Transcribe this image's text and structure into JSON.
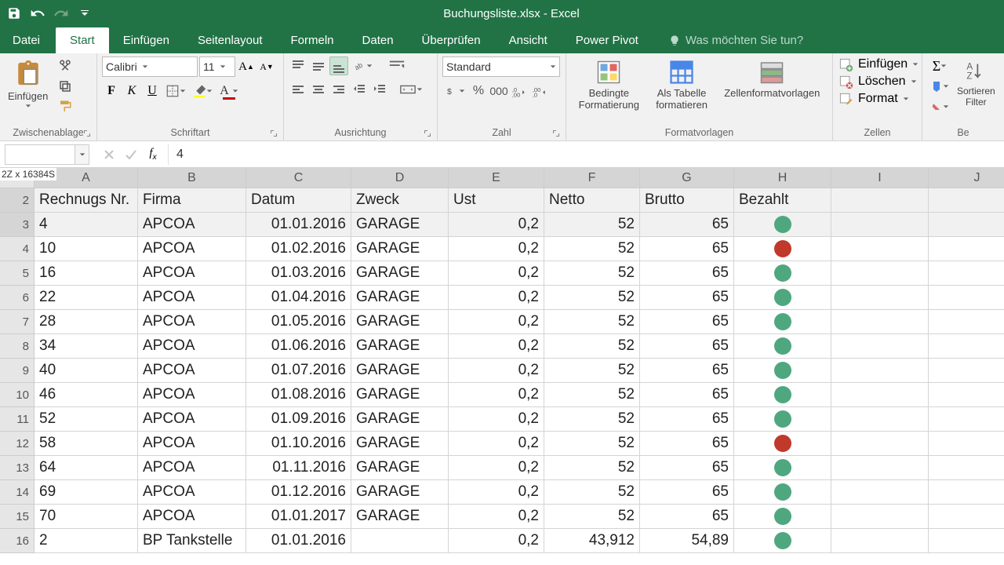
{
  "title": "Buchungsliste.xlsx - Excel",
  "tabs": {
    "file": "Datei",
    "home": "Start",
    "insert": "Einfügen",
    "layout": "Seitenlayout",
    "formulas": "Formeln",
    "data": "Daten",
    "review": "Überprüfen",
    "view": "Ansicht",
    "pivot": "Power Pivot"
  },
  "tellme": "Was möchten Sie tun?",
  "groups": {
    "clipboard": "Zwischenablage",
    "font": "Schriftart",
    "align": "Ausrichtung",
    "number": "Zahl",
    "styles": "Formatvorlagen",
    "cells": "Zellen",
    "editing": "Be"
  },
  "clipboard": {
    "paste": "Einfügen"
  },
  "font": {
    "name": "Calibri",
    "size": "11"
  },
  "number": {
    "format": "Standard"
  },
  "styles": {
    "cond": "Bedingte\nFormatierung",
    "table": "Als Tabelle\nformatieren",
    "cellstyles": "Zellenformatvorlagen"
  },
  "cells": {
    "insert": "Einfügen",
    "delete": "Löschen",
    "format": "Format"
  },
  "editing": {
    "sort": "Sortieren\nFilter"
  },
  "namebox": "",
  "formula": "4",
  "selection_size": "2Z x 16384S",
  "columns": [
    "A",
    "B",
    "C",
    "D",
    "E",
    "F",
    "G",
    "H",
    "I",
    "J"
  ],
  "headers": {
    "a": "Rechnugs Nr.",
    "b": "Firma",
    "c": "Datum",
    "d": "Zweck",
    "e": "Ust",
    "f": "Netto",
    "g": "Brutto",
    "h": "Bezahlt"
  },
  "rows": [
    {
      "n": 2,
      "a": "Rechnugs Nr.",
      "b": "Firma",
      "c": "Datum",
      "d": "Zweck",
      "e": "Ust",
      "f": "Netto",
      "g": "Brutto",
      "h": "Bezahlt",
      "hdr": true,
      "sel": true,
      "hd": "text"
    },
    {
      "n": 3,
      "a": "4",
      "b": "APCOA",
      "c": "01.01.2016",
      "d": "GARAGE",
      "e": "0,2",
      "f": "52",
      "g": "65",
      "h": "green",
      "sel": true
    },
    {
      "n": 4,
      "a": "10",
      "b": "APCOA",
      "c": "01.02.2016",
      "d": "GARAGE",
      "e": "0,2",
      "f": "52",
      "g": "65",
      "h": "red"
    },
    {
      "n": 5,
      "a": "16",
      "b": "APCOA",
      "c": "01.03.2016",
      "d": "GARAGE",
      "e": "0,2",
      "f": "52",
      "g": "65",
      "h": "green"
    },
    {
      "n": 6,
      "a": "22",
      "b": "APCOA",
      "c": "01.04.2016",
      "d": "GARAGE",
      "e": "0,2",
      "f": "52",
      "g": "65",
      "h": "green"
    },
    {
      "n": 7,
      "a": "28",
      "b": "APCOA",
      "c": "01.05.2016",
      "d": "GARAGE",
      "e": "0,2",
      "f": "52",
      "g": "65",
      "h": "green"
    },
    {
      "n": 8,
      "a": "34",
      "b": "APCOA",
      "c": "01.06.2016",
      "d": "GARAGE",
      "e": "0,2",
      "f": "52",
      "g": "65",
      "h": "green"
    },
    {
      "n": 9,
      "a": "40",
      "b": "APCOA",
      "c": "01.07.2016",
      "d": "GARAGE",
      "e": "0,2",
      "f": "52",
      "g": "65",
      "h": "green"
    },
    {
      "n": 10,
      "a": "46",
      "b": "APCOA",
      "c": "01.08.2016",
      "d": "GARAGE",
      "e": "0,2",
      "f": "52",
      "g": "65",
      "h": "green"
    },
    {
      "n": 11,
      "a": "52",
      "b": "APCOA",
      "c": "01.09.2016",
      "d": "GARAGE",
      "e": "0,2",
      "f": "52",
      "g": "65",
      "h": "green"
    },
    {
      "n": 12,
      "a": "58",
      "b": "APCOA",
      "c": "01.10.2016",
      "d": "GARAGE",
      "e": "0,2",
      "f": "52",
      "g": "65",
      "h": "red"
    },
    {
      "n": 13,
      "a": "64",
      "b": "APCOA",
      "c": "01.11.2016",
      "d": "GARAGE",
      "e": "0,2",
      "f": "52",
      "g": "65",
      "h": "green"
    },
    {
      "n": 14,
      "a": "69",
      "b": "APCOA",
      "c": "01.12.2016",
      "d": "GARAGE",
      "e": "0,2",
      "f": "52",
      "g": "65",
      "h": "green"
    },
    {
      "n": 15,
      "a": "70",
      "b": "APCOA",
      "c": "01.01.2017",
      "d": "GARAGE",
      "e": "0,2",
      "f": "52",
      "g": "65",
      "h": "green"
    },
    {
      "n": 16,
      "a": "2",
      "b": "BP Tankstelle",
      "c": "01.01.2016",
      "d": "",
      "e": "0,2",
      "f": "43,912",
      "g": "54,89",
      "h": "green"
    }
  ]
}
